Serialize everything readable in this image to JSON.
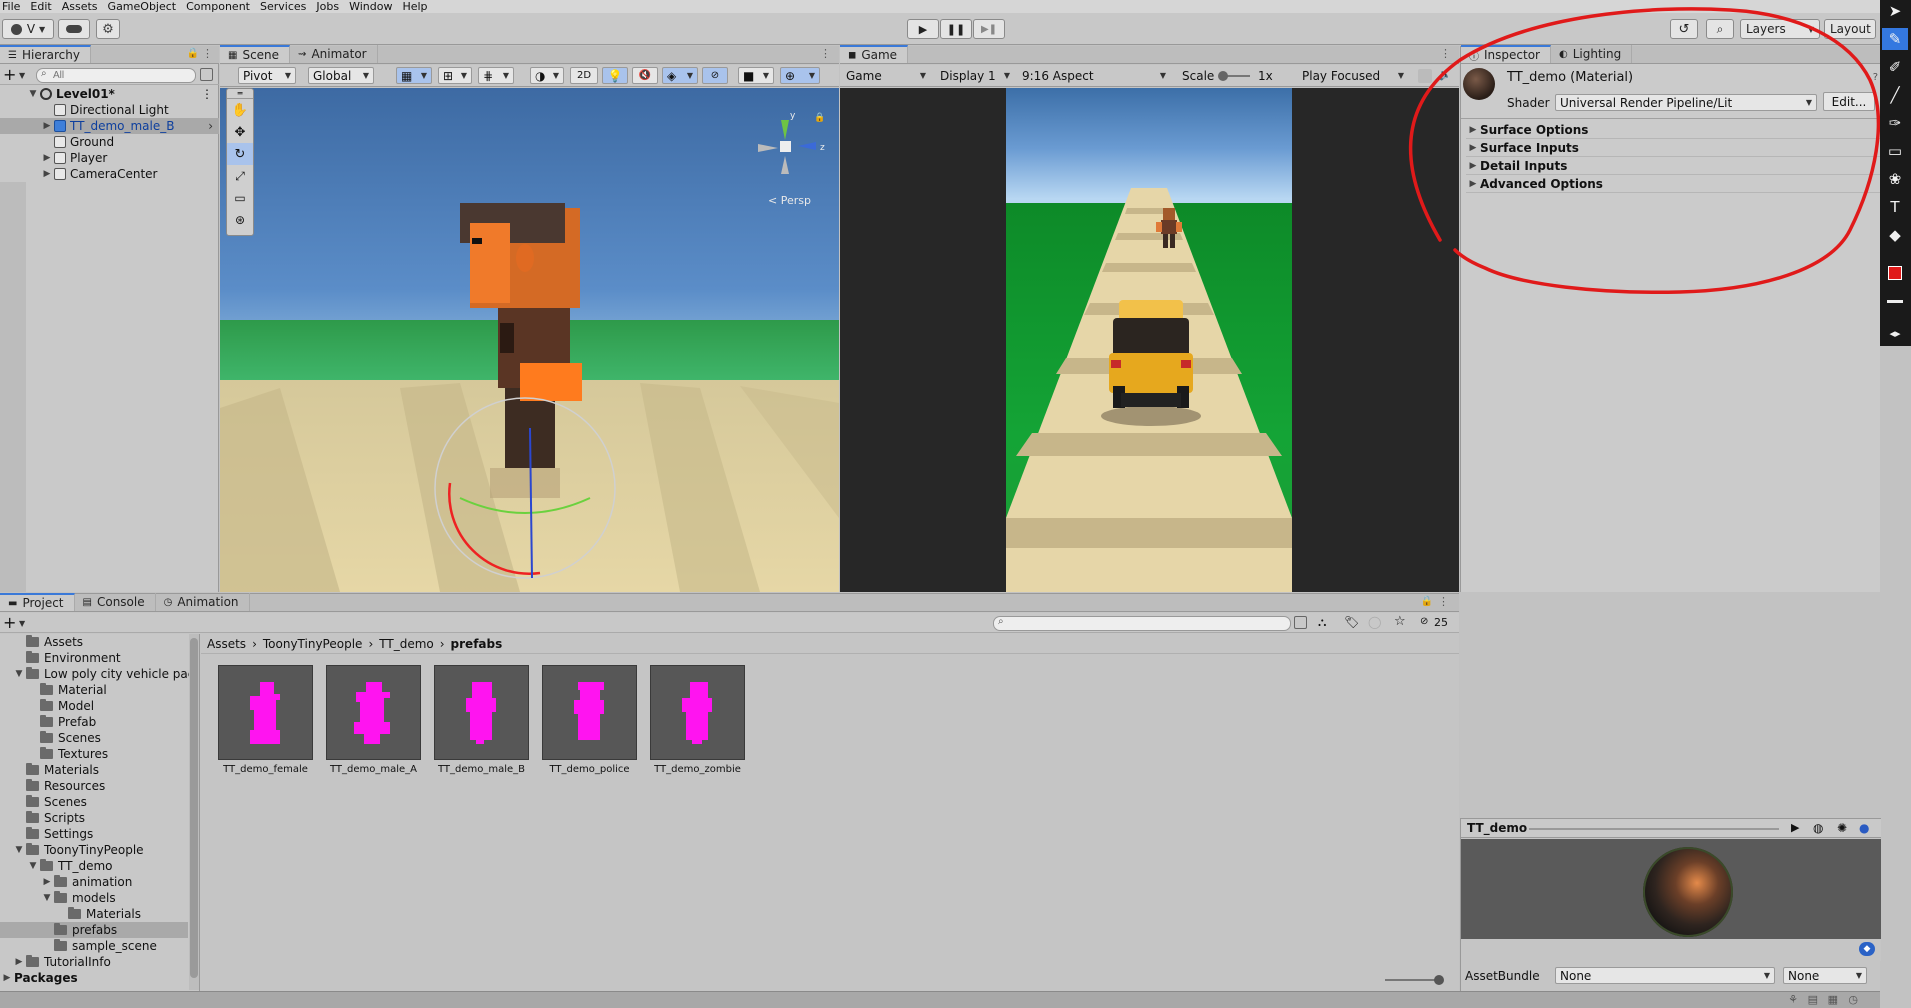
{
  "menu": [
    "File",
    "Edit",
    "Assets",
    "GameObject",
    "Component",
    "Services",
    "Jobs",
    "Window",
    "Help"
  ],
  "toolbar": {
    "account_label": "V",
    "layers_label": "Layers",
    "layout_label": "Layout"
  },
  "hierarchy": {
    "tab": "Hierarchy",
    "search_placeholder": "All",
    "items": [
      {
        "label": "Level01*"
      },
      {
        "label": "Directional Light"
      },
      {
        "label": "TT_demo_male_B"
      },
      {
        "label": "Ground"
      },
      {
        "label": "Player"
      },
      {
        "label": "CameraCenter"
      }
    ]
  },
  "scene": {
    "tabs": [
      "Scene",
      "Animator"
    ],
    "pivot_label": "Pivot",
    "global_label": "Global",
    "mode_2d": "2D",
    "persp_label": "< Persp",
    "axis_y": "y",
    "axis_z": "z"
  },
  "game": {
    "tab": "Game",
    "game_dropdown": "Game",
    "display": "Display 1",
    "aspect": "9:16 Aspect",
    "scale_label": "Scale",
    "scale_value": "1x",
    "play_mode": "Play Focused"
  },
  "inspector": {
    "tabs": [
      "Inspector",
      "Lighting"
    ],
    "material_name": "TT_demo (Material)",
    "shader_label": "Shader",
    "shader_value": "Universal Render Pipeline/Lit",
    "edit_button": "Edit...",
    "sections": [
      "Surface Options",
      "Surface Inputs",
      "Detail Inputs",
      "Advanced Options"
    ],
    "preview_title": "TT_demo",
    "assetbundle_label": "AssetBundle",
    "assetbundle_value": "None",
    "assetbundle_variant": "None"
  },
  "project": {
    "tabs": [
      "Project",
      "Console",
      "Animation"
    ],
    "hidden_count": "25",
    "breadcrumb": [
      "Assets",
      "ToonyTinyPeople",
      "TT_demo",
      "prefabs"
    ],
    "tree": [
      {
        "label": "Assets"
      },
      {
        "label": "Environment"
      },
      {
        "label": "Low poly city vehicle pacl"
      },
      {
        "label": "Material"
      },
      {
        "label": "Model"
      },
      {
        "label": "Prefab"
      },
      {
        "label": "Scenes"
      },
      {
        "label": "Textures"
      },
      {
        "label": "Materials"
      },
      {
        "label": "Resources"
      },
      {
        "label": "Scenes"
      },
      {
        "label": "Scripts"
      },
      {
        "label": "Settings"
      },
      {
        "label": "ToonyTinyPeople"
      },
      {
        "label": "TT_demo"
      },
      {
        "label": "animation"
      },
      {
        "label": "models"
      },
      {
        "label": "Materials"
      },
      {
        "label": "prefabs"
      },
      {
        "label": "sample_scene"
      },
      {
        "label": "TutorialInfo"
      },
      {
        "label": "Packages"
      }
    ],
    "prefabs": [
      "TT_demo_female",
      "TT_demo_male_A",
      "TT_demo_male_B",
      "TT_demo_police",
      "TT_demo_zombie"
    ]
  },
  "colors": {
    "annotation": "#e01a1a",
    "accent": "#3a79d8",
    "prefab_pink": "#ff14f0"
  }
}
